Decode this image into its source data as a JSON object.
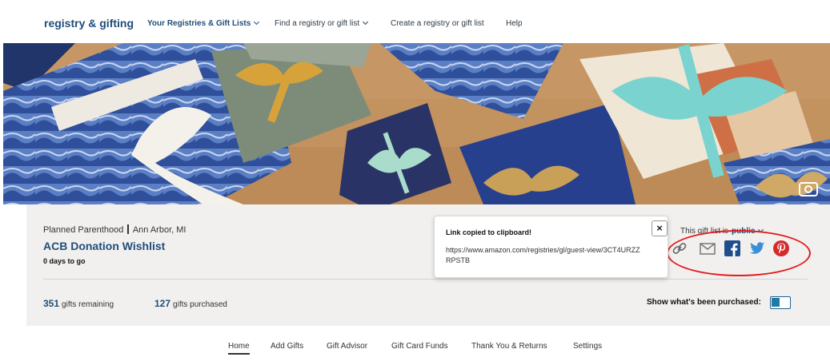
{
  "nav": {
    "brand": "registry & gifting",
    "links": [
      {
        "label": "Your Registries & Gift Lists",
        "dropdown": true
      },
      {
        "label": "Find a registry or gift list",
        "dropdown": true
      },
      {
        "label": "Create a registry or gift list",
        "dropdown": false
      },
      {
        "label": "Help",
        "dropdown": false
      }
    ]
  },
  "registry": {
    "owner": "Planned Parenthood",
    "location": "Ann Arbor, MI",
    "title": "ACB Donation Wishlist",
    "days_to_go": "0 days to go",
    "gifts_remaining_count": "351",
    "gifts_remaining_label": "gifts remaining",
    "gifts_purchased_count": "127",
    "gifts_purchased_label": "gifts purchased",
    "show_purchased_label": "Show what's been purchased:"
  },
  "visibility": {
    "label": "This gift list is",
    "value": "public"
  },
  "share": {
    "icons": [
      "link-icon",
      "email-icon",
      "facebook-icon",
      "twitter-icon",
      "pinterest-icon"
    ]
  },
  "popup": {
    "title": "Link copied to clipboard!",
    "url": "https://www.amazon.com/registries/gl/guest-view/3CT4URZZRPSTB",
    "close": "×"
  },
  "tabs": [
    "Home",
    "Add Gifts",
    "Gift Advisor",
    "Gift Card Funds",
    "Thank You & Returns",
    "Settings"
  ],
  "colors": {
    "accent": "#1f4e79",
    "annotation": "#e11b1b",
    "facebook": "#1f4e8c",
    "twitter": "#3b8fd6",
    "pinterest": "#d42a2a"
  }
}
